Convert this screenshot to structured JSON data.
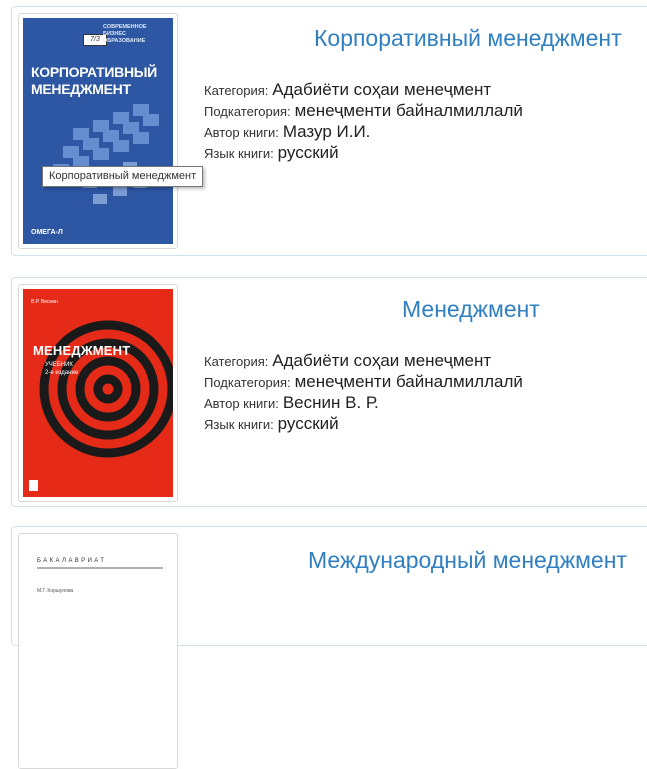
{
  "books": [
    {
      "title": "Корпоративный менеджмент",
      "category_label": "Категория:",
      "category": "Адабиёти соҳаи менеҷмент",
      "subcategory_label": "Подкатегория:",
      "subcategory": "менеҷменти байналмиллалӣ",
      "author_label": "Автор книги:",
      "author": "Мазур И.И.",
      "language_label": "Язык книги:",
      "language": "русский",
      "cover": {
        "series": "СОВРЕМЕННОЕ БИЗНЕС ОБРАЗОВАНИЕ",
        "title": "КОРПОРАТИВНЫЙ МЕНЕДЖМЕНТ",
        "stamp": "7/3",
        "publisher": "ОМЕГА-Л"
      }
    },
    {
      "title": "Менеджмент",
      "category_label": "Категория:",
      "category": "Адабиёти соҳаи менеҷмент",
      "subcategory_label": "Подкатегория:",
      "subcategory": "менеҷменти байналмиллалӣ",
      "author_label": "Автор книги:",
      "author": "Веснин В. Р.",
      "language_label": "Язык книги:",
      "language": "русский",
      "cover": {
        "author": "В.Р. Веснин",
        "title": "МЕНЕДЖМЕНТ",
        "subtitle": "УЧЕБНИК",
        "edition": "2-е издание"
      }
    },
    {
      "title": "Международный менеджмент",
      "cover": {
        "bar": "БАКАЛАВРИАТ",
        "author": "М.Г. Коршунова"
      }
    }
  ],
  "tooltip": "Корпоративный менеджмент"
}
